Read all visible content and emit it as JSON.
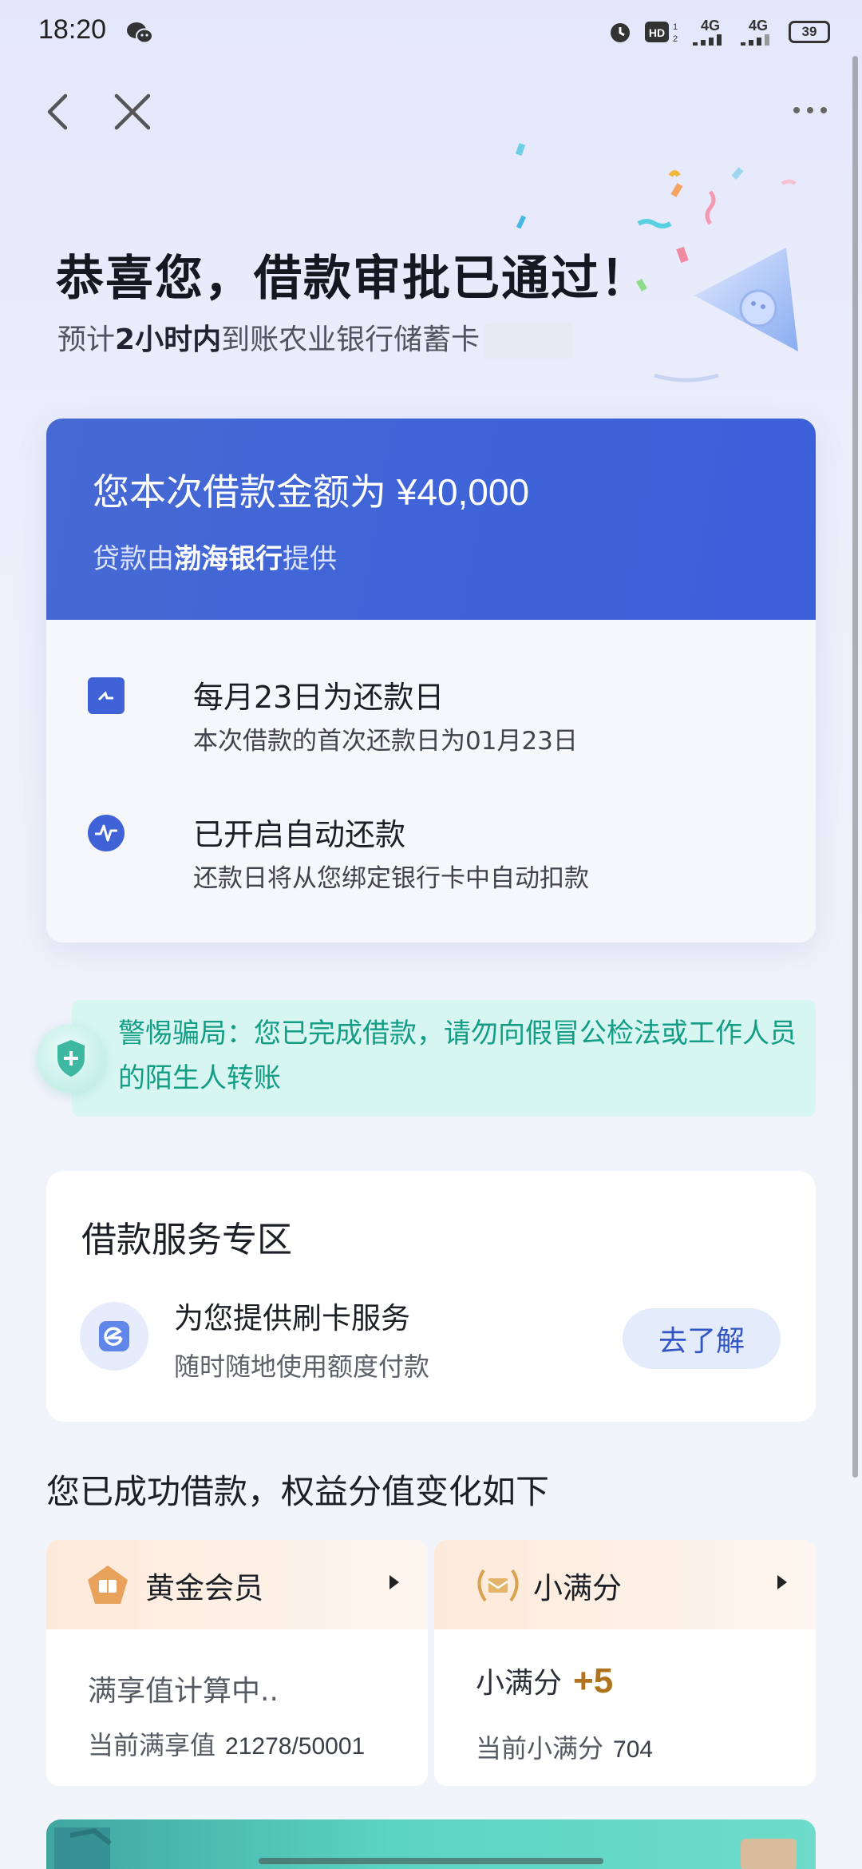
{
  "status_bar": {
    "time": "18:20",
    "network1": "4G",
    "network2": "4G",
    "battery": "39"
  },
  "hero": {
    "title": "恭喜您，借款审批已通过！",
    "sub_prefix": "预计",
    "sub_bold": "2小时内",
    "sub_suffix": "到账农业银行储蓄卡"
  },
  "loan": {
    "amount_text": "您本次借款金额为 ¥40,000",
    "bank_prefix": "贷款由",
    "bank_name": "渤海银行",
    "bank_suffix": "提供",
    "repay_day_title": "每月23日为还款日",
    "repay_day_desc": "本次借款的首次还款日为01月23日",
    "auto_title": "已开启自动还款",
    "auto_desc": "还款日将从您绑定银行卡中自动扣款"
  },
  "warning": {
    "text": "警惕骗局：您已完成借款，请勿向假冒公检法或工作人员的陌生人转账"
  },
  "service": {
    "section_title": "借款服务专区",
    "item_title": "为您提供刷卡服务",
    "item_desc": "随时随地使用额度付款",
    "button": "去了解"
  },
  "rights": {
    "title": "您已成功借款，权益分值变化如下",
    "gold": {
      "name": "黄金会员",
      "status": "满享值计算中..",
      "current_label": "当前满享值",
      "current_value": "21278/50001"
    },
    "score": {
      "name": "小满分",
      "change_label": "小满分",
      "change_value": "+5",
      "current_label": "当前小满分",
      "current_value": "704"
    }
  },
  "colors": {
    "primary_blue": "#3e63d8",
    "warn_green": "#139d84",
    "gold": "#b0741f"
  },
  "icons": [
    "back-icon",
    "close-icon",
    "more-icon",
    "calendar-icon",
    "auto-repay-icon",
    "shield-icon",
    "card-service-icon",
    "gold-member-icon",
    "laurel-icon",
    "chevron-right-icon"
  ]
}
